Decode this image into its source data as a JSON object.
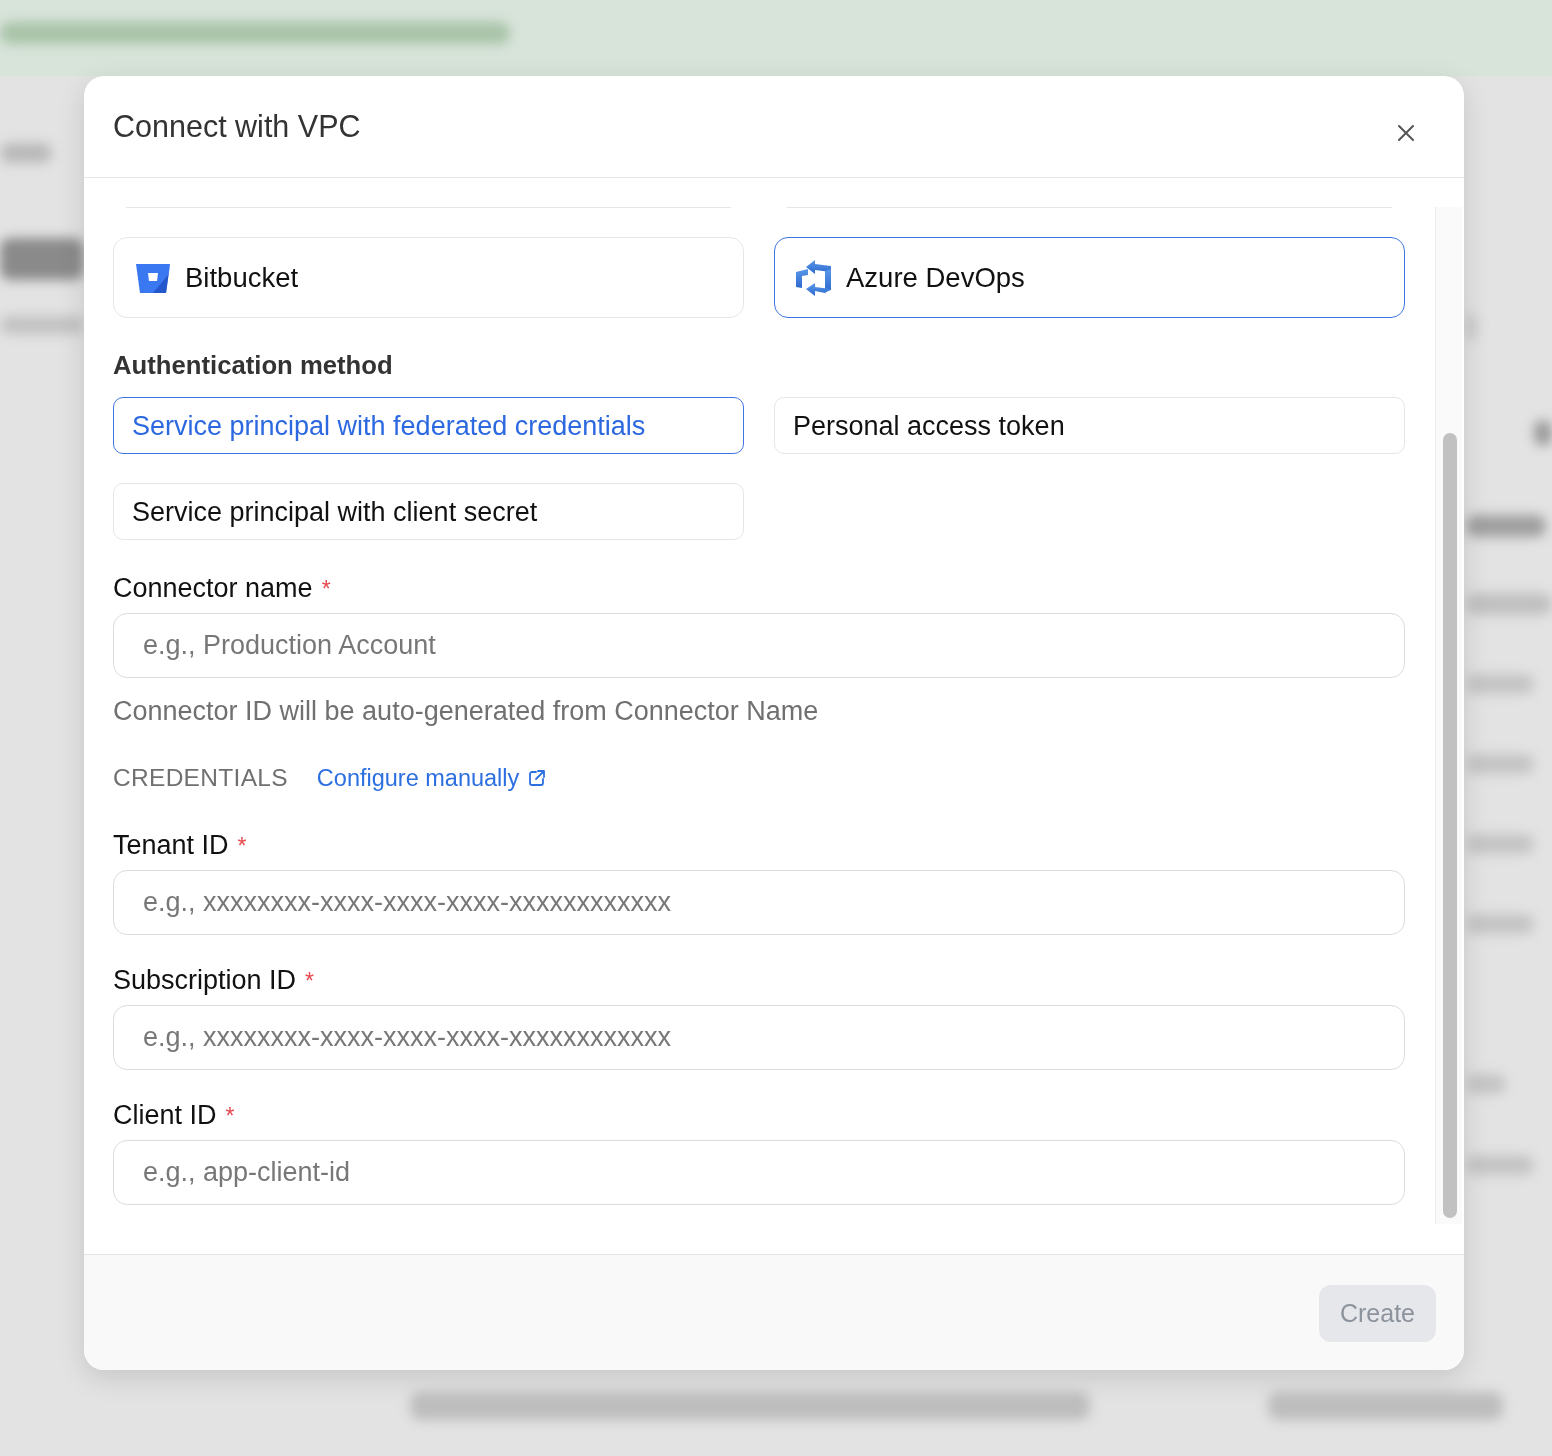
{
  "dialog": {
    "title": "Connect with VPC"
  },
  "providers": [
    {
      "name": "Bitbucket",
      "kind": "bitbucket",
      "selected": false
    },
    {
      "name": "Azure DevOps",
      "kind": "azure",
      "selected": true
    }
  ],
  "auth": {
    "label": "Authentication method",
    "options": [
      {
        "label": "Service principal with federated credentials",
        "selected": true
      },
      {
        "label": "Personal access token",
        "selected": false
      },
      {
        "label": "Service principal with client secret",
        "selected": false
      }
    ]
  },
  "connector_name": {
    "label": "Connector name",
    "required_mark": "*",
    "placeholder": "e.g., Production Account",
    "hint": "Connector ID will be auto-generated from Connector Name"
  },
  "credentials": {
    "heading": "CREDENTIALS",
    "link": "Configure manually",
    "fields": [
      {
        "label": "Tenant ID",
        "required_mark": "*",
        "placeholder": "e.g., xxxxxxxx-xxxx-xxxx-xxxx-xxxxxxxxxxxx"
      },
      {
        "label": "Subscription ID",
        "required_mark": "*",
        "placeholder": "e.g., xxxxxxxx-xxxx-xxxx-xxxx-xxxxxxxxxxxx"
      },
      {
        "label": "Client ID",
        "required_mark": "*",
        "placeholder": "e.g., app-client-id"
      }
    ]
  },
  "footer": {
    "create_button": {
      "label": "Create",
      "disabled": true
    }
  }
}
